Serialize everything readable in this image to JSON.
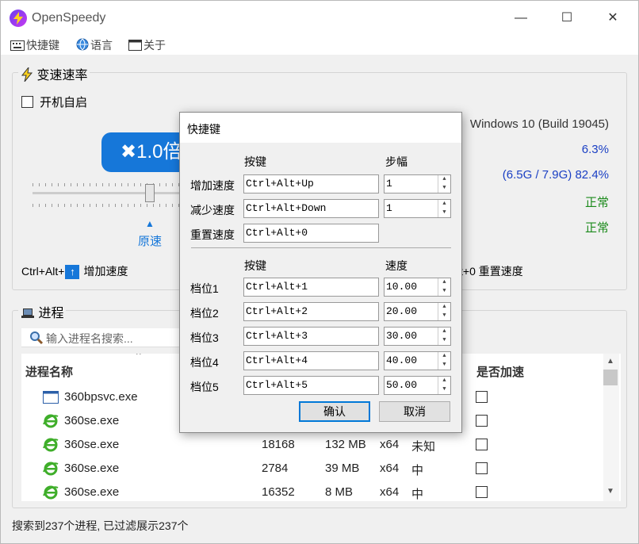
{
  "window": {
    "title": "OpenSpeedy",
    "controls": {
      "minimize": "—",
      "maximize": "☐",
      "close": "✕"
    }
  },
  "menu": {
    "hotkeys": "快捷键",
    "language": "语言",
    "about": "关于"
  },
  "speed_group": {
    "title": "变速速率",
    "autostart_label": "开机自启",
    "autostart_checked": false,
    "speed_display": "✖1.0倍",
    "reset_arrow": "▲",
    "reset_label": "原速",
    "hint_prefix": "Ctrl+Alt+",
    "hint_up_icon": "↑",
    "hint_increase": "增加速度",
    "hint_reset": "t+0 重置速度"
  },
  "system_info": {
    "os": "Windows 10 (Build 19045)",
    "cpu": "6.3%",
    "memory": "(6.5G / 7.9G) 82.4%",
    "status1": "正常",
    "status2": "正常"
  },
  "process_group": {
    "title": "进程",
    "search_placeholder": "输入进程名搜索...",
    "col_name": "进程名称",
    "col_accel": "是否加速",
    "sort_indicator": "^",
    "rows": [
      {
        "name": "360bpsvc.exe",
        "pid": "",
        "mem": "",
        "arch": "",
        "level": "",
        "icon": "window-icon"
      },
      {
        "name": "360se.exe",
        "pid": "",
        "mem": "",
        "arch": "",
        "level": "",
        "icon": "ie-icon"
      },
      {
        "name": "360se.exe",
        "pid": "18168",
        "mem": "132 MB",
        "arch": "x64",
        "level": "未知",
        "icon": "ie-icon"
      },
      {
        "name": "360se.exe",
        "pid": "2784",
        "mem": "39 MB",
        "arch": "x64",
        "level": "中",
        "icon": "ie-icon"
      },
      {
        "name": "360se.exe",
        "pid": "16352",
        "mem": "8 MB",
        "arch": "x64",
        "level": "中",
        "icon": "ie-icon"
      }
    ]
  },
  "status_bar": "搜索到237个进程, 已过滤展示237个",
  "dialog": {
    "title": "快捷键",
    "header_key": "按键",
    "header_step": "步幅",
    "increase_label": "增加速度",
    "increase_key": "Ctrl+Alt+Up",
    "increase_step": "1",
    "decrease_label": "减少速度",
    "decrease_key": "Ctrl+Alt+Down",
    "decrease_step": "1",
    "reset_label": "重置速度",
    "reset_key": "Ctrl+Alt+0",
    "header_key2": "按键",
    "header_speed": "速度",
    "levels": [
      {
        "label": "档位1",
        "key": "Ctrl+Alt+1",
        "speed": "10.00"
      },
      {
        "label": "档位2",
        "key": "Ctrl+Alt+2",
        "speed": "20.00"
      },
      {
        "label": "档位3",
        "key": "Ctrl+Alt+3",
        "speed": "30.00"
      },
      {
        "label": "档位4",
        "key": "Ctrl+Alt+4",
        "speed": "40.00"
      },
      {
        "label": "档位5",
        "key": "Ctrl+Alt+5",
        "speed": "50.00"
      }
    ],
    "confirm": "确认",
    "cancel": "取消"
  }
}
